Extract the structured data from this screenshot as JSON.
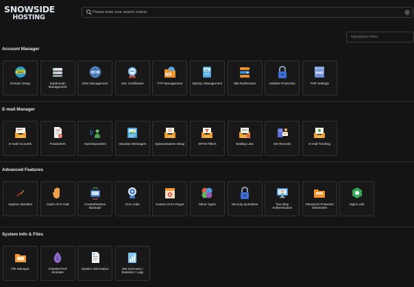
{
  "brand": {
    "line1": "SNOWSIDE",
    "line2": "HOSTING"
  },
  "search": {
    "placeholder": "Please enter your search criteria"
  },
  "nav_filter": {
    "placeholder": "Navigation Filter"
  },
  "sections": [
    {
      "title": "Account Manager",
      "items": [
        {
          "label": "Domain Setup",
          "icon": "globe-www-icon"
        },
        {
          "label": "Subdomain Management",
          "icon": "server-rack-icon"
        },
        {
          "label": "DNS Management",
          "icon": "dns-globe-icon"
        },
        {
          "label": "SSL Certificates",
          "icon": "ssl-certificate-icon"
        },
        {
          "label": "FTP Management",
          "icon": "ftp-folder-icon"
        },
        {
          "label": "MySQL Management",
          "icon": "mysql-database-icon"
        },
        {
          "label": "Site Redirection",
          "icon": "redirect-arrows-icon"
        },
        {
          "label": "Hotlinks Protection",
          "icon": "padlock-icon"
        },
        {
          "label": "PHP Settings",
          "icon": "php-icon"
        }
      ]
    },
    {
      "title": "E-mail Manager",
      "items": [
        {
          "label": "E-mail Accounts",
          "icon": "email-accounts-icon"
        },
        {
          "label": "Forwarders",
          "icon": "forwarders-icon"
        },
        {
          "label": "Autoresponders",
          "icon": "autoresponder-icon"
        },
        {
          "label": "Vacation Messages",
          "icon": "vacation-message-icon"
        },
        {
          "label": "Spamassassin Setup",
          "icon": "spamassassin-icon"
        },
        {
          "label": "SPAM Filters",
          "icon": "spam-filter-icon"
        },
        {
          "label": "Mailing Lists",
          "icon": "mailing-list-icon"
        },
        {
          "label": "MX Records",
          "icon": "mx-records-icon"
        },
        {
          "label": "E-mail Tracking",
          "icon": "email-tracking-icon"
        }
      ]
    },
    {
      "title": "Advanced Features",
      "items": [
        {
          "label": "Apache Handlers",
          "icon": "apache-feather-icon"
        },
        {
          "label": "Catch-All E-mail",
          "icon": "catch-all-hand-icon"
        },
        {
          "label": "Create/Restore Backups",
          "icon": "backup-icon"
        },
        {
          "label": "Cron Jobs",
          "icon": "cron-robot-icon"
        },
        {
          "label": "Custom Error Pages",
          "icon": "error-page-icon"
        },
        {
          "label": "Mime Types",
          "icon": "mime-types-icon"
        },
        {
          "label": "Security Questions",
          "icon": "security-lock-icon"
        },
        {
          "label": "Two-Step Authentication",
          "icon": "two-step-auth-icon"
        },
        {
          "label": "Password Protected Directories",
          "icon": "protected-folder-icon"
        },
        {
          "label": "Nginx Unit",
          "icon": "nginx-unit-icon"
        }
      ]
    },
    {
      "title": "System Info & Files",
      "items": [
        {
          "label": "File Manager",
          "icon": "file-manager-icon"
        },
        {
          "label": "Installed Perl Modules",
          "icon": "perl-onion-icon"
        },
        {
          "label": "System Information",
          "icon": "system-info-icon"
        },
        {
          "label": "Site Summary / Statistics / Logs",
          "icon": "statistics-icon"
        }
      ]
    }
  ]
}
